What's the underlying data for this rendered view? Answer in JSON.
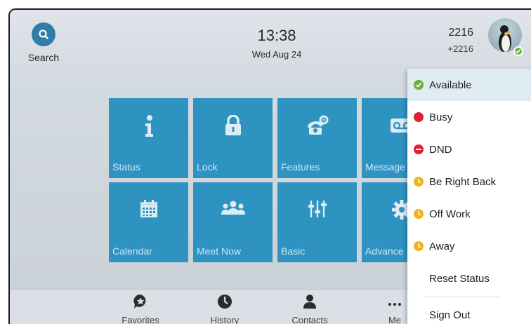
{
  "header": {
    "search_label": "Search",
    "time": "13:38",
    "date": "Wed Aug 24",
    "account_name": "2216",
    "account_number": "+2216"
  },
  "tiles": [
    {
      "label": "Status",
      "icon": "info-icon"
    },
    {
      "label": "Lock",
      "icon": "lock-icon"
    },
    {
      "label": "Features",
      "icon": "phone-gear-icon"
    },
    {
      "label": "Message",
      "icon": "voicemail-icon"
    },
    {
      "label": "Calendar",
      "icon": "calendar-icon"
    },
    {
      "label": "Meet Now",
      "icon": "group-icon"
    },
    {
      "label": "Basic",
      "icon": "sliders-icon"
    },
    {
      "label": "Advance",
      "icon": "gear-icon"
    }
  ],
  "bottom_nav": [
    {
      "label": "Favorites",
      "icon": "star-bubble-icon"
    },
    {
      "label": "History",
      "icon": "clock-icon"
    },
    {
      "label": "Contacts",
      "icon": "person-icon"
    },
    {
      "label": "Me",
      "icon": "more-icon"
    }
  ],
  "status_menu": {
    "items": [
      {
        "label": "Available",
        "status": "available",
        "color": "#6ab03a",
        "selected": true
      },
      {
        "label": "Busy",
        "status": "busy",
        "color": "#e0202e",
        "selected": false
      },
      {
        "label": "DND",
        "status": "dnd",
        "color": "#e0202e",
        "selected": false
      },
      {
        "label": "Be Right Back",
        "status": "brb",
        "color": "#f0b21a",
        "selected": false
      },
      {
        "label": "Off Work",
        "status": "off-work",
        "color": "#f0b21a",
        "selected": false
      },
      {
        "label": "Away",
        "status": "away",
        "color": "#f0b21a",
        "selected": false
      },
      {
        "label": "Reset Status",
        "status": "reset",
        "selected": false
      },
      {
        "label": "Sign Out",
        "status": "sign-out",
        "selected": false
      }
    ]
  },
  "colors": {
    "tile": "#2f93c2",
    "accent": "#2f7da8",
    "available": "#6ab03a",
    "busy": "#e0202e",
    "away": "#f0b21a"
  }
}
